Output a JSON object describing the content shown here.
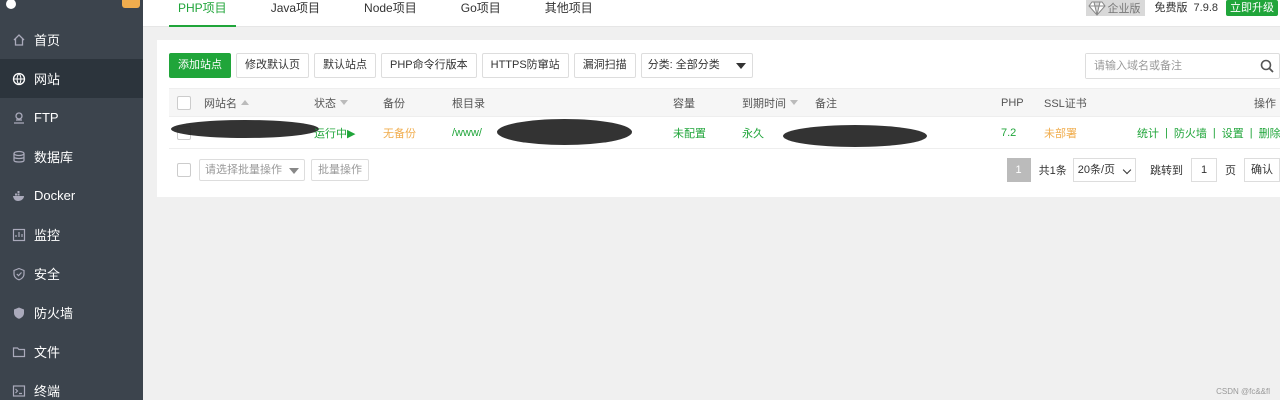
{
  "sidebar": {
    "brand": "",
    "badge": "",
    "items": [
      {
        "label": "首页",
        "icon": "home-icon"
      },
      {
        "label": "网站",
        "icon": "globe-icon"
      },
      {
        "label": "FTP",
        "icon": "ftp-icon"
      },
      {
        "label": "数据库",
        "icon": "database-icon"
      },
      {
        "label": "Docker",
        "icon": "docker-icon"
      },
      {
        "label": "监控",
        "icon": "monitor-icon"
      },
      {
        "label": "安全",
        "icon": "shield-icon"
      },
      {
        "label": "防火墙",
        "icon": "firewall-icon"
      },
      {
        "label": "文件",
        "icon": "folder-icon"
      },
      {
        "label": "终端",
        "icon": "terminal-icon"
      }
    ],
    "active_index": 1
  },
  "tabs": [
    "PHP项目",
    "Java项目",
    "Node项目",
    "Go项目",
    "其他项目"
  ],
  "active_tab": 0,
  "header": {
    "enterprise": "企业版",
    "free": "免费版",
    "version": "7.9.8",
    "upgrade": "立即升级"
  },
  "toolbar": {
    "add_site": "添加站点",
    "edit_default_page": "修改默认页",
    "default_site": "默认站点",
    "php_cli": "PHP命令行版本",
    "https_firewall": "HTTPS防窜站",
    "vuln_scan": "漏洞扫描",
    "category": "分类: 全部分类"
  },
  "search": {
    "placeholder": "请输入域名或备注"
  },
  "table": {
    "headers": {
      "name": "网站名",
      "status": "状态",
      "backup": "备份",
      "root": "根目录",
      "quota": "容量",
      "expire": "到期时间",
      "remark": "备注",
      "php": "PHP",
      "ssl": "SSL证书",
      "ops": "操作"
    },
    "rows": [
      {
        "status": "运行中▶",
        "backup": "无备份",
        "root": "/www/",
        "quota": "未配置",
        "expire": "永久",
        "php": "7.2",
        "ssl": "未部署",
        "ops": [
          "统计",
          "防火墙",
          "设置",
          "删除"
        ]
      }
    ]
  },
  "footer": {
    "batch_placeholder": "请选择批量操作",
    "batch_button": "批量操作",
    "current_page": "1",
    "total": "共1条",
    "page_size": "20条/页",
    "jump_to": "跳转到",
    "jump_value": "1",
    "page_unit": "页",
    "confirm": "确认"
  },
  "colors": {
    "accent": "#20a53a",
    "sidebar": "#3c444d",
    "warning": "#f0ad4e"
  },
  "watermark": "CSDN @fc&&fl"
}
